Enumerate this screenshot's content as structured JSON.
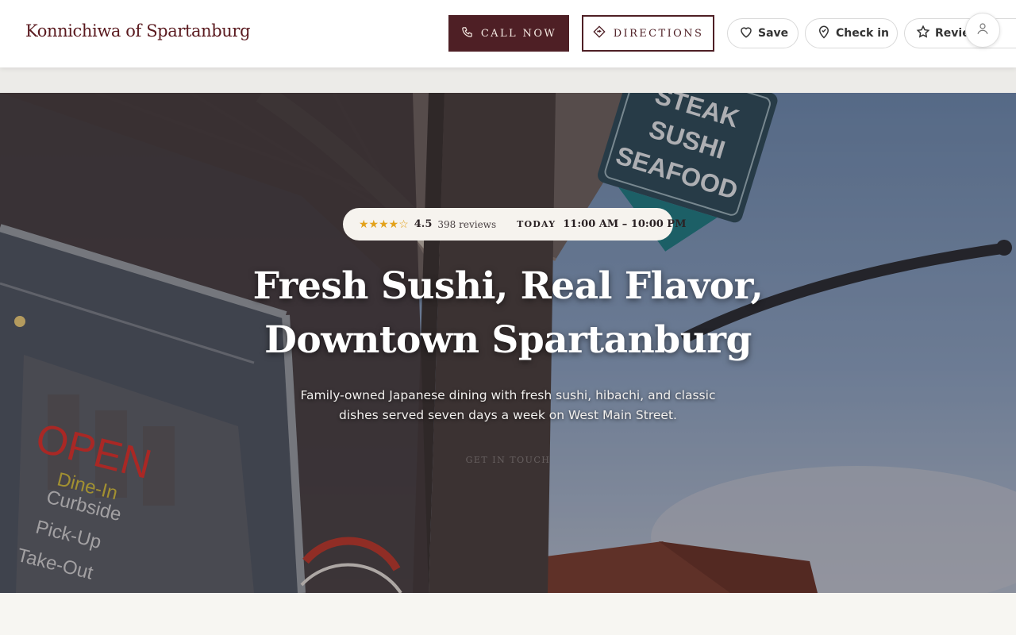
{
  "header": {
    "brand": "Konnichiwa of Spartanburg",
    "call_label": "CALL NOW",
    "directions_label": "DIRECTIONS",
    "save_label": "Save",
    "checkin_label": "Check in",
    "review_label": "Review"
  },
  "hero": {
    "stars": "★★★★☆",
    "rating": "4.5",
    "reviews": "398 reviews",
    "today_label": "TODAY",
    "hours": "11:00 AM – 10:00 PM",
    "title": "Fresh Sushi, Real Flavor, Downtown Spartanburg",
    "subtitle": "Family-owned Japanese dining with fresh sushi, hibachi, and classic dishes served seven days a week on West Main Street.",
    "faint_text": "GET IN TOUCH"
  },
  "photo_signs": {
    "sign_line1": "STEAK",
    "sign_line2": "SUSHI",
    "sign_line3": "SEAFOOD",
    "open": "OPEN",
    "dine_in": "Dine-In",
    "curbside": "Curbside",
    "pickup": "Pick-Up",
    "takeout": "Take-Out"
  },
  "colors": {
    "brand": "#5a1a1f",
    "call_bg": "#4e1f25",
    "star": "#e3a21a"
  },
  "icons": {
    "call": "phone-icon",
    "directions": "directions-icon",
    "save": "heart-icon",
    "checkin": "map-pin-icon",
    "review": "star-icon",
    "avatar": "user-icon"
  }
}
